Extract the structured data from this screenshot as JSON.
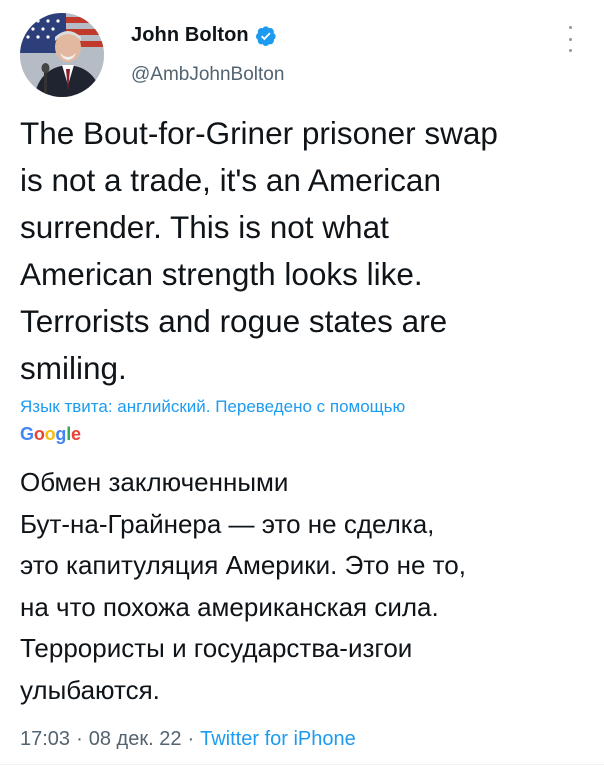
{
  "author": {
    "display_name": "John Bolton",
    "handle": "@AmbJohnBolton",
    "verified_icon": "verified-badge-icon",
    "accent_color": "#1d9bf0"
  },
  "tweet": {
    "text": "The Bout-for-Griner prisoner swap\nis not a trade, it's an American\nsurrender. This is not what\nAmerican strength looks like.\nTerrorists and rogue states are\nsmiling.",
    "translation_note": "Язык твита: английский. Переведено с помощью",
    "translation_provider": "Google",
    "translated_text": "Обмен заключенными\nБут-на-Грайнера — это не сделка,\nэто капитуляция Америки. Это не то,\nна что похожа американская сила.\nТеррористы и государства-изгои\nулыбаются."
  },
  "meta": {
    "time": "17:03",
    "separator": "·",
    "date": "08 дек. 22",
    "source": "Twitter for iPhone"
  },
  "icons": {
    "more": "more-vertical-icon"
  }
}
